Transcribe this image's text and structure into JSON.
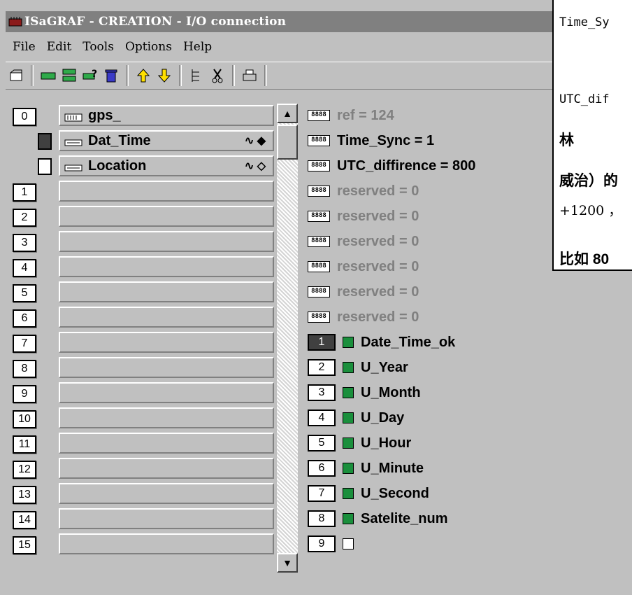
{
  "window": {
    "title": "ISaGRAF - CREATION - I/O connection"
  },
  "menu": [
    {
      "label": "File"
    },
    {
      "label": "Edit"
    },
    {
      "label": "Tools"
    },
    {
      "label": "Options"
    },
    {
      "label": "Help"
    }
  ],
  "toolbar": [
    "open-icon",
    "card-icon",
    "card-stack-icon",
    "help-card-icon",
    "delete-icon",
    "up-arrow-icon",
    "down-arrow-icon",
    "tree-icon",
    "cut-icon",
    "print-icon"
  ],
  "slots": [
    "0",
    "1",
    "2",
    "3",
    "4",
    "5",
    "6",
    "7",
    "8",
    "9",
    "10",
    "11",
    "12",
    "13",
    "14",
    "15"
  ],
  "slot_cells": [
    {
      "label": "gps_",
      "sub": false
    },
    {
      "label": "Dat_Time",
      "sub": true,
      "tail": "∿ ◆"
    },
    {
      "label": "Location",
      "sub": true,
      "tail": "∿ ◇"
    }
  ],
  "analog": {
    "icon_text": "8888",
    "items": [
      {
        "text": "ref = 124",
        "active": false
      },
      {
        "text": "Time_Sync = 1",
        "active": true
      },
      {
        "text": "UTC_diffirence = 800",
        "active": true
      },
      {
        "text": "reserved = 0",
        "active": false
      },
      {
        "text": "reserved = 0",
        "active": false
      },
      {
        "text": "reserved = 0",
        "active": false
      },
      {
        "text": "reserved = 0",
        "active": false
      },
      {
        "text": "reserved = 0",
        "active": false
      },
      {
        "text": "reserved = 0",
        "active": false
      }
    ]
  },
  "digital": [
    {
      "num": "1",
      "text": "Date_Time_ok",
      "on": true
    },
    {
      "num": "2",
      "text": "U_Year",
      "on": false
    },
    {
      "num": "3",
      "text": "U_Month",
      "on": false
    },
    {
      "num": "4",
      "text": "U_Day",
      "on": false
    },
    {
      "num": "5",
      "text": "U_Hour",
      "on": false
    },
    {
      "num": "6",
      "text": "U_Minute",
      "on": false
    },
    {
      "num": "7",
      "text": "U_Second",
      "on": false
    },
    {
      "num": "8",
      "text": "Satelite_num",
      "on": false
    },
    {
      "num": "9",
      "text": "",
      "on": false
    }
  ],
  "overlay": {
    "line1": "Time_Sy",
    "line2": "UTC_dif",
    "line3": "林",
    "line4": "威治）的",
    "line5": "+1200 ，",
    "line6": "比如 80"
  }
}
